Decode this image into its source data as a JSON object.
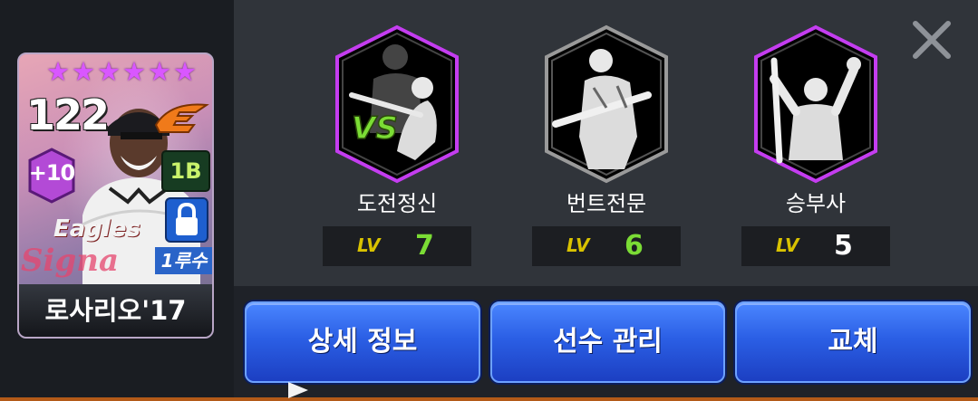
{
  "card": {
    "stars": [
      "★",
      "★",
      "★",
      "★",
      "★",
      "★"
    ],
    "overall": "122",
    "enhance": "+10",
    "position": "1B",
    "jersey_text": "Eagles",
    "signature_text": "Signa",
    "batting_order": "1루수",
    "player_name": "로사리오'17",
    "lock_icon": "lock-icon",
    "team_logo_icon": "eagles-logo-icon"
  },
  "skills": [
    {
      "name": "도전정신",
      "lv_label": "LV",
      "level": "7",
      "level_color": "#7bdc35",
      "frame_color": "#c43df0",
      "icon": "versus-batter-icon"
    },
    {
      "name": "번트전문",
      "lv_label": "LV",
      "level": "6",
      "level_color": "#7bdc35",
      "frame_color": "#9a9a9a",
      "icon": "bunt-batter-icon"
    },
    {
      "name": "승부사",
      "lv_label": "LV",
      "level": "5",
      "level_color": "#ffffff",
      "frame_color": "#c43df0",
      "icon": "celebrating-batter-icon"
    }
  ],
  "buttons": {
    "detail": "상세 정보",
    "manage": "선수 관리",
    "swap": "교체"
  },
  "close_icon": "close-icon",
  "colors": {
    "accent_blue": "#2b5fe5",
    "star_purple": "#d957ff"
  }
}
